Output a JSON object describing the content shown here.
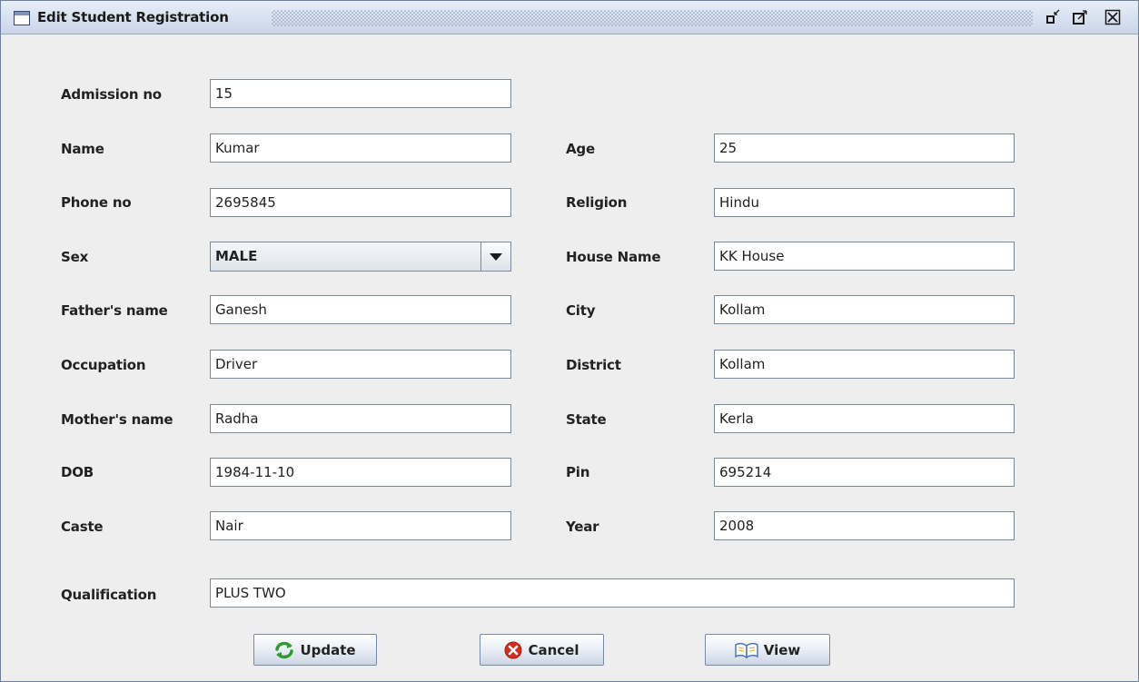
{
  "window": {
    "title": "Edit Student Registration"
  },
  "form": {
    "admission_no": {
      "label": "Admission no",
      "value": "15"
    },
    "name": {
      "label": "Name",
      "value": "Kumar"
    },
    "phone_no": {
      "label": "Phone no",
      "value": "2695845"
    },
    "sex": {
      "label": "Sex",
      "value": "MALE"
    },
    "fathers_name": {
      "label": "Father's name",
      "value": "Ganesh"
    },
    "occupation": {
      "label": "Occupation",
      "value": "Driver"
    },
    "mothers_name": {
      "label": "Mother's name",
      "value": "Radha"
    },
    "dob": {
      "label": "DOB",
      "value": "1984-11-10"
    },
    "caste": {
      "label": "Caste",
      "value": "Nair"
    },
    "age": {
      "label": "Age",
      "value": "25"
    },
    "religion": {
      "label": "Religion",
      "value": "Hindu"
    },
    "house_name": {
      "label": "House Name",
      "value": "KK House"
    },
    "city": {
      "label": "City",
      "value": "Kollam"
    },
    "district": {
      "label": "District",
      "value": "Kollam"
    },
    "state": {
      "label": "State",
      "value": "Kerla"
    },
    "pin": {
      "label": "Pin",
      "value": "695214"
    },
    "year": {
      "label": "Year",
      "value": "2008"
    },
    "qualification": {
      "label": "Qualification",
      "value": "PLUS TWO"
    }
  },
  "buttons": {
    "update": {
      "label": "Update",
      "icon": "refresh-icon"
    },
    "cancel": {
      "label": "Cancel",
      "icon": "cancel-icon"
    },
    "view": {
      "label": "View",
      "icon": "book-icon"
    }
  },
  "colors": {
    "title_bar": "#c9d5e8",
    "update_icon": "#2e9b2e",
    "cancel_icon": "#d42c1c",
    "view_icon": "#4a76c8"
  }
}
